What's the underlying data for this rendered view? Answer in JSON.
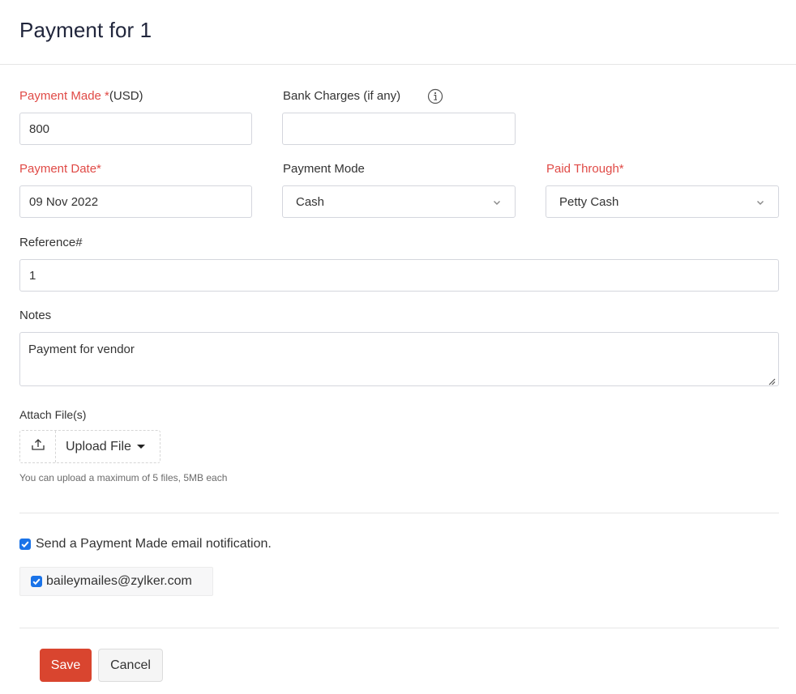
{
  "header": {
    "title": "Payment for 1"
  },
  "form": {
    "payment_made": {
      "label": "Payment Made *",
      "unit": "(USD)",
      "value": "800",
      "required": true
    },
    "bank_charges": {
      "label": "Bank Charges (if any)",
      "value": "",
      "info_icon": "info-icon"
    },
    "payment_date": {
      "label": "Payment Date*",
      "value": "09 Nov 2022",
      "required": true
    },
    "payment_mode": {
      "label": "Payment Mode",
      "selected": "Cash"
    },
    "paid_through": {
      "label": "Paid Through*",
      "selected": "Petty Cash",
      "required": true
    },
    "reference": {
      "label": "Reference#",
      "value": "1"
    },
    "notes": {
      "label": "Notes",
      "value": "Payment for vendor"
    },
    "attachments": {
      "label": "Attach File(s)",
      "upload_label": "Upload File",
      "upload_icon": "upload-icon",
      "hint": "You can upload a maximum of 5 files, 5MB each"
    }
  },
  "notification": {
    "label": "Send a Payment Made email notification.",
    "checked": true,
    "recipients": [
      {
        "email": "baileymailes@zylker.com",
        "checked": true
      }
    ]
  },
  "actions": {
    "save_label": "Save",
    "cancel_label": "Cancel"
  },
  "colors": {
    "required": "#e04a46",
    "primary": "#d9452f",
    "checkbox": "#1a73e8"
  }
}
